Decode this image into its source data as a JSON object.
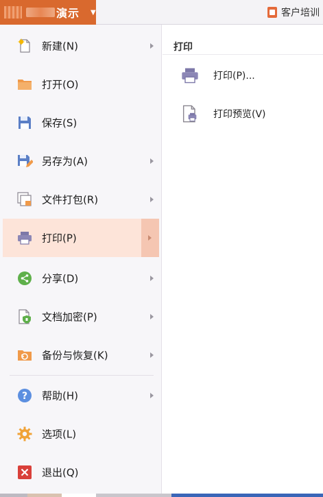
{
  "titlebar": {
    "app_title": "演示",
    "menu_caret": "▼",
    "right_tab_label": "客户培训"
  },
  "menu": {
    "items": [
      {
        "label": "新建(N)",
        "icon": "new-doc-icon",
        "has_submenu": true
      },
      {
        "label": "打开(O)",
        "icon": "folder-open-icon",
        "has_submenu": false
      },
      {
        "label": "保存(S)",
        "icon": "save-disk-icon",
        "has_submenu": false
      },
      {
        "label": "另存为(A)",
        "icon": "save-as-icon",
        "has_submenu": true
      },
      {
        "label": "文件打包(R)",
        "icon": "package-icon",
        "has_submenu": true
      },
      {
        "label": "打印(P)",
        "icon": "printer-icon",
        "has_submenu": true,
        "active": true
      },
      {
        "label": "分享(D)",
        "icon": "share-icon",
        "has_submenu": true
      },
      {
        "label": "文档加密(P)",
        "icon": "encrypt-doc-icon",
        "has_submenu": true
      },
      {
        "label": "备份与恢复(K)",
        "icon": "backup-restore-icon",
        "has_submenu": true
      },
      {
        "label": "帮助(H)",
        "icon": "help-icon",
        "has_submenu": true
      },
      {
        "label": "选项(L)",
        "icon": "gear-icon",
        "has_submenu": false
      },
      {
        "label": "退出(Q)",
        "icon": "exit-icon",
        "has_submenu": false
      }
    ]
  },
  "submenu": {
    "title": "打印",
    "items": [
      {
        "label": "打印(P)...",
        "icon": "printer-icon"
      },
      {
        "label": "打印预览(V)",
        "icon": "print-preview-icon"
      }
    ]
  },
  "colors": {
    "accent": "#d9692e",
    "active_bg": "#fde4d9",
    "active_arrow_bg": "#f5c6b2",
    "menu_bg": "#f7f6f9"
  }
}
